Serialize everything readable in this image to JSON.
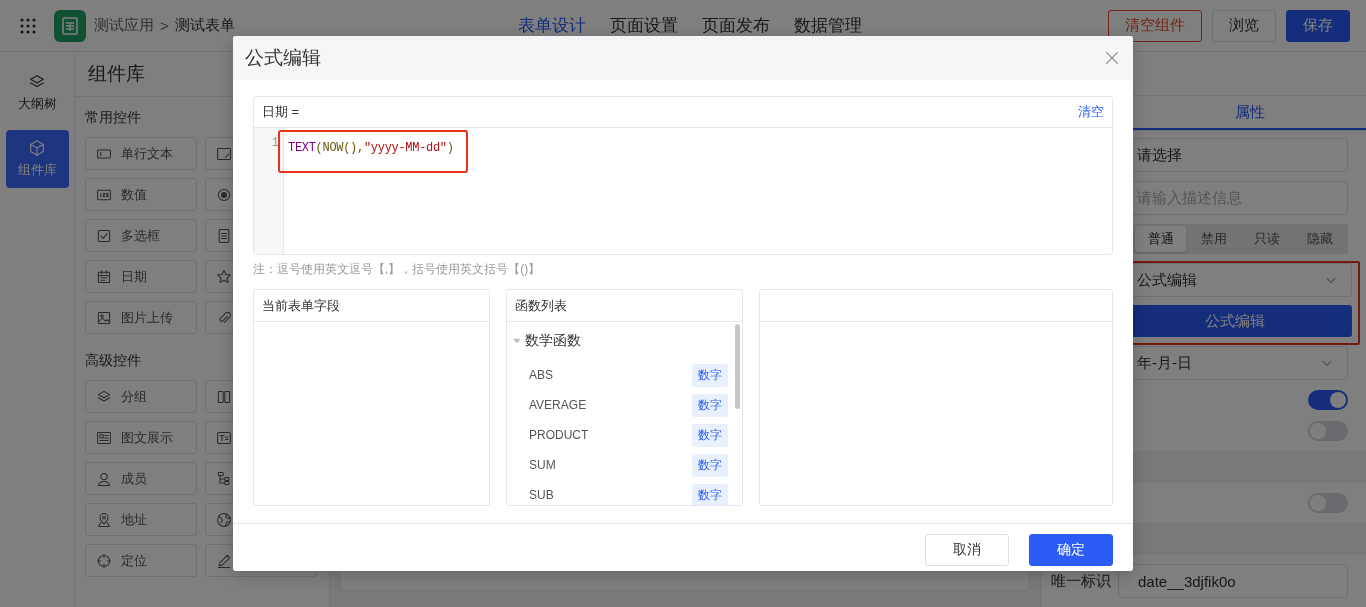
{
  "topbar": {
    "app_name": "测试应用",
    "separator": ">",
    "form_name": "测试表单",
    "nav": [
      {
        "label": "表单设计",
        "selected": true
      },
      {
        "label": "页面设置",
        "selected": false
      },
      {
        "label": "页面发布",
        "selected": false
      },
      {
        "label": "数据管理",
        "selected": false
      }
    ],
    "buttons": [
      {
        "label": "清空组件",
        "kind": "danger"
      },
      {
        "label": "浏览",
        "kind": "default"
      },
      {
        "label": "保存",
        "kind": "primary"
      }
    ]
  },
  "rail": {
    "items": [
      {
        "label": "大纲树",
        "selected": false
      },
      {
        "label": "组件库",
        "selected": true
      }
    ]
  },
  "library": {
    "title": "组件库",
    "sections": [
      {
        "title": "常用控件",
        "items": [
          "单行文本",
          "数值",
          "多选框",
          "日期",
          "图片上传"
        ]
      },
      {
        "title": "高级控件",
        "items": [
          "分组",
          "图文展示",
          "成员",
          "地址",
          "定位"
        ]
      }
    ]
  },
  "properties": {
    "tabs": [
      {
        "label": "属性",
        "selected": true
      }
    ],
    "fields": [
      {
        "kind": "input",
        "value": "请选择"
      },
      {
        "kind": "textarea",
        "placeholder": "请输入描述信息"
      },
      {
        "kind": "segmented",
        "options": [
          {
            "label": "普通",
            "selected": true
          },
          {
            "label": "禁用",
            "selected": false
          },
          {
            "label": "只读",
            "selected": false
          },
          {
            "label": "隐藏",
            "selected": false
          }
        ]
      },
      {
        "kind": "group",
        "highlighted": true,
        "fields": [
          {
            "kind": "select",
            "value": "公式编辑"
          },
          {
            "kind": "button",
            "label": "公式编辑"
          }
        ]
      },
      {
        "kind": "select",
        "value": "年-月-日"
      },
      {
        "kind": "toggle",
        "on": true
      },
      {
        "kind": "toggle",
        "on": false
      },
      {
        "kind": "band"
      },
      {
        "kind": "toggle",
        "on": false
      },
      {
        "kind": "band"
      },
      {
        "kind": "labeled_input",
        "label": "唯一标识",
        "value": "date__3djfik0o"
      }
    ]
  },
  "modal": {
    "title": "公式编辑",
    "editor": {
      "field_label": "日期 =",
      "clear_link": "清空",
      "line_number": "1",
      "highlighted": true,
      "tokens": [
        {
          "text": "TEXT",
          "kind": "keyword"
        },
        {
          "text": "(NOW(),",
          "kind": "plain"
        },
        {
          "text": "\"yyyy-MM-dd\"",
          "kind": "string"
        },
        {
          "text": ")",
          "kind": "plain"
        }
      ]
    },
    "note": "注：逗号使用英文逗号【,】，括号使用英文括号【()】",
    "panels": [
      {
        "kind": "fields",
        "title": "当前表单字段"
      },
      {
        "kind": "functions",
        "title": "函数列表",
        "groups": [
          {
            "name": "数学函数",
            "expanded": true,
            "functions": [
              {
                "name": "ABS",
                "tag": "数字"
              },
              {
                "name": "AVERAGE",
                "tag": "数字"
              },
              {
                "name": "PRODUCT",
                "tag": "数字"
              },
              {
                "name": "SUM",
                "tag": "数字"
              },
              {
                "name": "SUB",
                "tag": "数字"
              }
            ]
          }
        ]
      },
      {
        "kind": "details"
      }
    ],
    "buttons": [
      {
        "label": "取消",
        "kind": "default"
      },
      {
        "label": "确定",
        "kind": "primary"
      }
    ]
  }
}
